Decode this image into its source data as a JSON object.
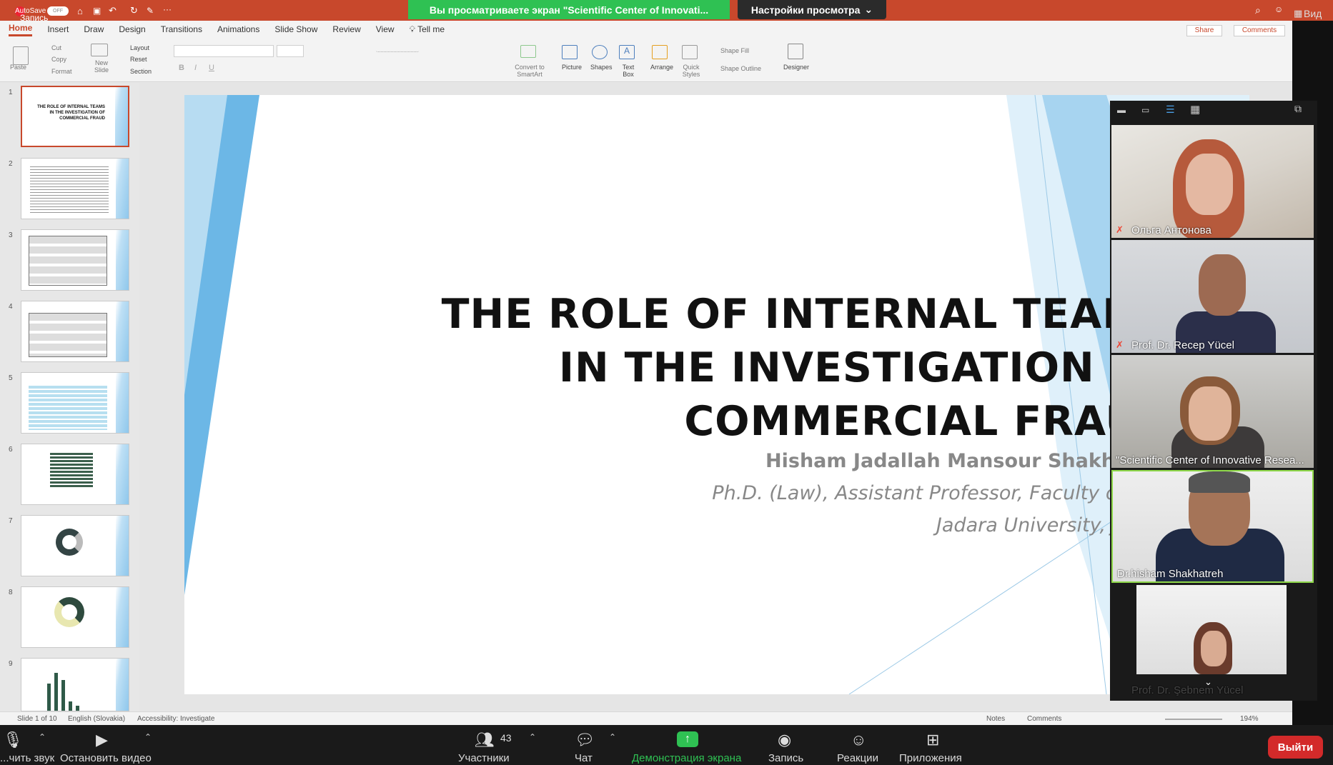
{
  "titlebar": {
    "autosave_label": "AutoSave",
    "autosave_state": "OFF",
    "record_label": "Запись",
    "share_banner": "Вы просматриваете экран \"Scientific Center of Innovati...",
    "view_settings": "Настройки просмотра",
    "view_label": "Вид"
  },
  "ribbon_tabs": [
    "Home",
    "Insert",
    "Draw",
    "Design",
    "Transitions",
    "Animations",
    "Slide Show",
    "Review",
    "View",
    "Tell me"
  ],
  "ribbon_right": {
    "share": "Share",
    "comments": "Comments"
  },
  "ribbon": {
    "paste": "Paste",
    "cut": "Cut",
    "copy": "Copy",
    "format": "Format",
    "new_slide": "New Slide",
    "layout": "Layout",
    "reset": "Reset",
    "section": "Section",
    "convert": "Convert to SmartArt",
    "picture": "Picture",
    "shapes": "Shapes",
    "textbox": "Text Box",
    "arrange": "Arrange",
    "quick_styles": "Quick Styles",
    "shape_fill": "Shape Fill",
    "shape_outline": "Shape Outline",
    "designer": "Designer"
  },
  "thumbnails": [
    {
      "num": "1",
      "title": "THE ROLE OF INTERNAL TEAMS IN THE INVESTIGATION OF COMMERCIAL FRAUD"
    },
    {
      "num": "2"
    },
    {
      "num": "3"
    },
    {
      "num": "4"
    },
    {
      "num": "5"
    },
    {
      "num": "6"
    },
    {
      "num": "7"
    },
    {
      "num": "8"
    },
    {
      "num": "9"
    }
  ],
  "slide": {
    "title_line1": "THE ROLE OF INTERNAL TEAMS",
    "title_line2": "IN THE INVESTIGATION OF",
    "title_line3": "COMMERCIAL FRAUD",
    "author": "Hisham Jadallah Mansour Shakhatreh",
    "affil1": "Ph.D. (Law), Assistant Professor, Faculty of Law,",
    "affil2": "Jadara University, Jordan"
  },
  "statusbar": {
    "slide_of": "Slide 1 of 10",
    "language": "English (Slovakia)",
    "accessibility": "Accessibility: Investigate",
    "notes": "Notes",
    "comments": "Comments",
    "zoom": "194%"
  },
  "participants": [
    {
      "name": "Ольга Антонова",
      "muted": true
    },
    {
      "name": "Prof. Dr. Recep Yücel",
      "muted": true
    },
    {
      "name": "\"Scientific Center of Innovative Resea...",
      "muted": false
    },
    {
      "name": "Dr.hisham Shakhatreh",
      "muted": false,
      "speaking": true
    },
    {
      "name": "Prof. Dr. Şebnem Yücel",
      "muted": true
    }
  ],
  "zoom_bar": {
    "audio": "...чить звук",
    "video": "Остановить видео",
    "participants": "Участники",
    "participants_count": "43",
    "chat": "Чат",
    "share": "Демонстрация экрана",
    "record": "Запись",
    "reactions": "Реакции",
    "apps": "Приложения",
    "leave": "Выйти"
  },
  "colors": {
    "titlebar": "#c8482c",
    "banner": "#2fc153",
    "leave": "#d32a2a",
    "accent_blue": "#5aa9e0"
  }
}
